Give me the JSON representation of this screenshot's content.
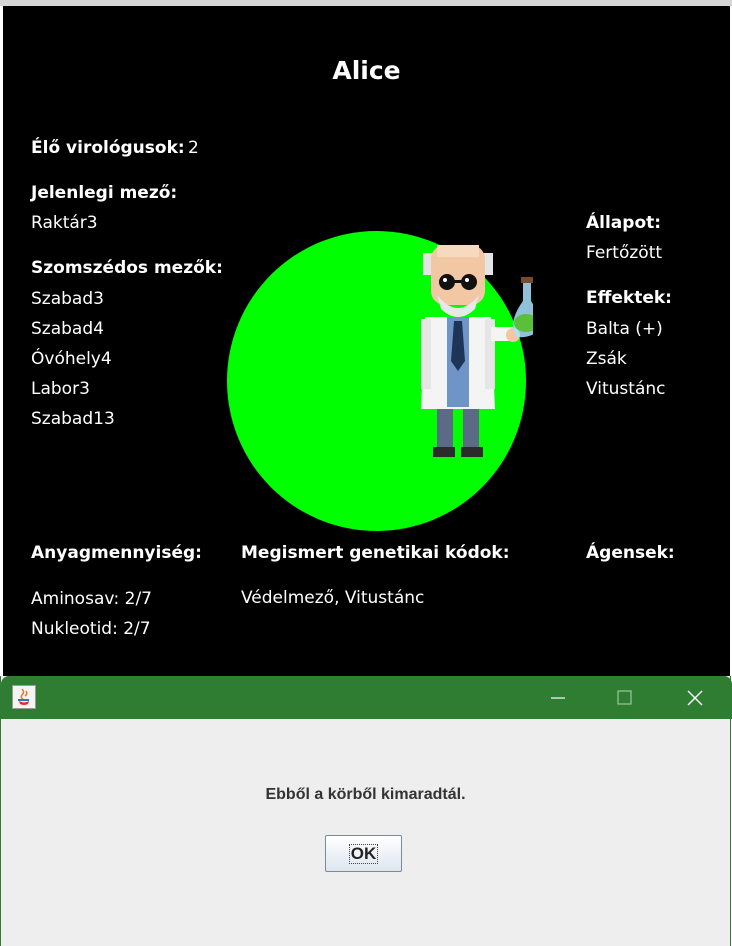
{
  "player": {
    "name": "Alice"
  },
  "stats": {
    "alive_label": "Élő virológusok:",
    "alive_value": "2",
    "current_field_label": "Jelenlegi mező:",
    "current_field_value": "Raktár3",
    "neighbors_label": "Szomszédos mezők:",
    "neighbors": [
      "Szabad3",
      "Szabad4",
      "Óvóhely4",
      "Labor3",
      "Szabad13"
    ],
    "state_label": "Állapot:",
    "state_value": "Fertőzött",
    "effects_label": "Effektek:",
    "effects": [
      "Balta (+)",
      "Zsák",
      "Vitustánc"
    ],
    "material_label": "Anyagmennyiség:",
    "materials": [
      "Aminosav: 2/7",
      "Nukleotid: 2/7"
    ],
    "codes_label": "Megismert genetikai kódok:",
    "codes_value": "Védelmező, Vitustánc",
    "agents_label": "Ágensek:"
  },
  "colors": {
    "circle": "#00ff00",
    "titlebar": "#2e7d32"
  },
  "dialog": {
    "message": "Ebből a körből kimaradtál.",
    "ok_label": "OK",
    "icons": [
      "java-icon",
      "minimize-icon",
      "maximize-icon",
      "close-icon"
    ]
  }
}
